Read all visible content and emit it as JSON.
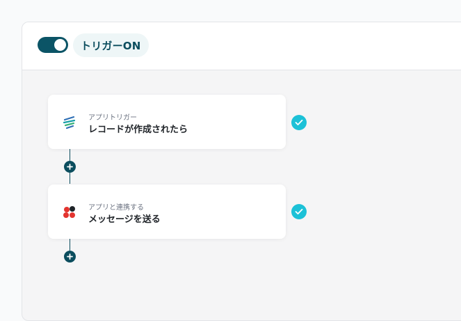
{
  "header": {
    "toggle_state": "on",
    "trigger_label": "トリガーON"
  },
  "flow": {
    "steps": [
      {
        "subtitle": "アプリトリガー",
        "title": "レコードが作成されたら",
        "icon": "kintone-app-icon",
        "status": "complete"
      },
      {
        "subtitle": "アプリと連携する",
        "title": "メッセージを送る",
        "icon": "chatwork-app-icon",
        "status": "complete"
      }
    ]
  },
  "colors": {
    "accent": "#0b4d5e",
    "check": "#1cc1d7",
    "card_bg": "#ffffff",
    "canvas_bg": "#f5f5f6"
  }
}
